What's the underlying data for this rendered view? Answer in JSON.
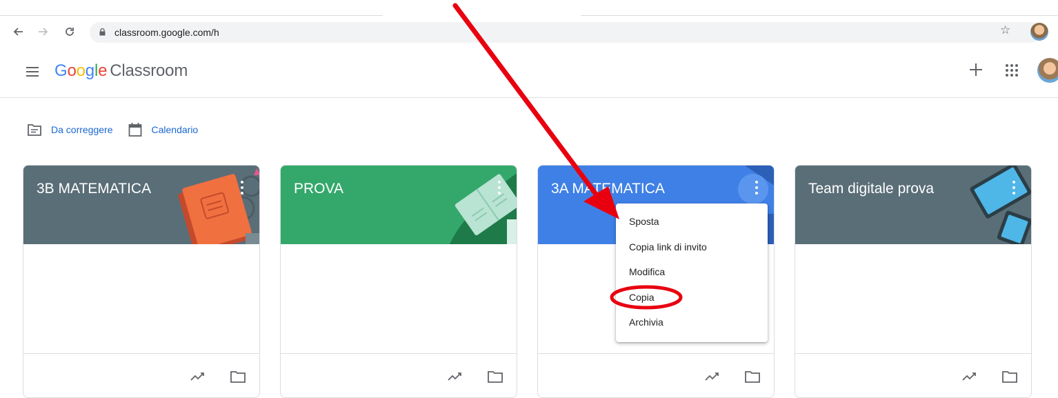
{
  "browser": {
    "url": "classroom.google.com/h",
    "icons": [
      "back-arrow-icon",
      "forward-arrow-icon",
      "reload-icon",
      "lock-icon",
      "star-icon"
    ]
  },
  "header": {
    "brand_google": "Google",
    "brand_letters": [
      "G",
      "o",
      "o",
      "g",
      "l",
      "e"
    ],
    "brand_product": "Classroom",
    "icons": [
      "menu-icon",
      "plus-icon",
      "apps-grid-icon"
    ]
  },
  "subnav": {
    "to_review": "Da correggere",
    "calendar": "Calendario"
  },
  "cards": [
    {
      "title": "3B MATEMATICA",
      "color": "#5a6e78"
    },
    {
      "title": "PROVA",
      "color": "#34a86b"
    },
    {
      "title": "3A MATEMATICA",
      "color": "#3f80e6"
    },
    {
      "title": "Team digitale prova",
      "color": "#5a6e78"
    }
  ],
  "menu": {
    "items": [
      "Sposta",
      "Copia link di invito",
      "Modifica",
      "Copia",
      "Archivia"
    ],
    "highlighted": "Copia"
  },
  "annotation_colors": {
    "arrow": "#e8000f",
    "circle": "#e8000f"
  },
  "colors": {
    "link_blue": "#1967d2",
    "icon_gray": "#5f6368"
  }
}
